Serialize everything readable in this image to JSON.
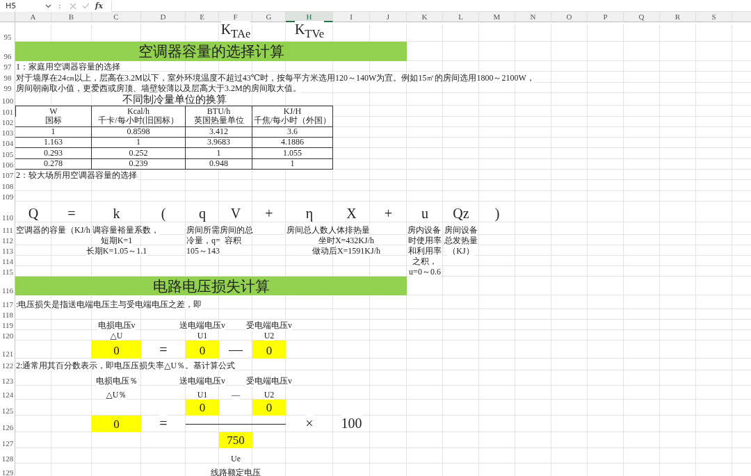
{
  "formula_bar": {
    "name_box": "H5",
    "separator": ":",
    "fx": "fx"
  },
  "columns": [
    {
      "letter": "A",
      "selected": false
    },
    {
      "letter": "B",
      "selected": false
    },
    {
      "letter": "C",
      "selected": false
    },
    {
      "letter": "D",
      "selected": false
    },
    {
      "letter": "E",
      "selected": false
    },
    {
      "letter": "F",
      "selected": false
    },
    {
      "letter": "G",
      "selected": false
    },
    {
      "letter": "H",
      "selected": true
    },
    {
      "letter": "I",
      "selected": false
    },
    {
      "letter": "J",
      "selected": false
    },
    {
      "letter": "K",
      "selected": false
    },
    {
      "letter": "L",
      "selected": false
    },
    {
      "letter": "M",
      "selected": false
    },
    {
      "letter": "N",
      "selected": false
    },
    {
      "letter": "O",
      "selected": false
    },
    {
      "letter": "P",
      "selected": false
    },
    {
      "letter": "Q",
      "selected": false
    },
    {
      "letter": "R",
      "selected": false
    },
    {
      "letter": "S",
      "selected": false
    }
  ],
  "rows": [
    {
      "number": "95",
      "cells": {
        "F": {
          "kind": "symbol",
          "text": "K$_{TAe}$"
        },
        "H": {
          "kind": "symbol",
          "text": "K$_{TVe}$"
        }
      }
    },
    {
      "number": "96",
      "cells": {
        "A-J": {
          "kind": "title",
          "text": "空调器容量的选择计算"
        }
      }
    },
    {
      "number": "97",
      "cells": {
        "A": {
          "kind": "text",
          "text": "1：家庭用空调器容量的选择"
        }
      }
    },
    {
      "number": "98",
      "cells": {
        "A": {
          "kind": "text",
          "text": "对于墙厚在24㎝以上，层高在3.2M以下，室外环境温度不超过43℃时，按每平方米选用120～140W为宜。例如15㎡的房间选用1800～2100W，"
        }
      }
    },
    {
      "number": "99",
      "cells": {
        "A": {
          "kind": "text",
          "text": "房间朝南取小值，更爱西或房顶、墙壁较薄以及层高大于3.2M的房间取大值。"
        }
      }
    },
    {
      "number": "100",
      "cells": {
        "A-H": {
          "kind": "heading",
          "text": "不同制冷量单位的换算"
        }
      }
    },
    {
      "number": "101",
      "cells": {
        "A-B": {
          "kind": "table-head",
          "text": "W"
        },
        "C-D": {
          "kind": "table-head",
          "text": "Kcal/h"
        },
        "E-F": {
          "kind": "table-head",
          "text": "BTU/h"
        },
        "G-H": {
          "kind": "table-head",
          "text": "KJ/H"
        }
      }
    },
    {
      "number": "102",
      "cells": {
        "A-B": {
          "kind": "table-sub",
          "text": "国标"
        },
        "C-D": {
          "kind": "table-sub",
          "text": "千卡/每小时(旧国标）"
        },
        "E-F": {
          "kind": "table-sub",
          "text": "英国热量单位"
        },
        "G-H": {
          "kind": "table-sub",
          "text": "千焦/每小时（外国）"
        }
      }
    },
    {
      "number": "103",
      "cells": {
        "A-B": {
          "kind": "table",
          "text": "1"
        },
        "C-D": {
          "kind": "table",
          "text": "0.8598"
        },
        "E-F": {
          "kind": "table",
          "text": "3.412"
        },
        "G-H": {
          "kind": "table",
          "text": "3.6"
        }
      }
    },
    {
      "number": "104",
      "cells": {
        "A-B": {
          "kind": "table",
          "text": "1.163"
        },
        "C-D": {
          "kind": "table",
          "text": "1"
        },
        "E-F": {
          "kind": "table",
          "text": "3.9683"
        },
        "G-H": {
          "kind": "table",
          "text": "4.1886"
        }
      }
    },
    {
      "number": "105",
      "cells": {
        "A-B": {
          "kind": "table",
          "text": "0.293"
        },
        "C-D": {
          "kind": "table",
          "text": "0.252"
        },
        "E-F": {
          "kind": "table",
          "text": "1"
        },
        "G-H": {
          "kind": "table",
          "text": "1.055"
        }
      }
    },
    {
      "number": "106",
      "cells": {
        "A-B": {
          "kind": "table",
          "text": "0.278"
        },
        "C-D": {
          "kind": "table",
          "text": "0.239"
        },
        "E-F": {
          "kind": "table",
          "text": "0.948"
        },
        "G-H": {
          "kind": "table",
          "text": "1"
        }
      }
    },
    {
      "number": "107",
      "cells": {
        "A": {
          "kind": "text",
          "text": "2：较大场所用空调器容量的选择"
        }
      }
    },
    {
      "number": "108"
    },
    {
      "number": "109"
    },
    {
      "number": "110",
      "cells": {
        "A": {
          "kind": "symbol",
          "text": "Q"
        },
        "B": {
          "kind": "symbol",
          "text": "="
        },
        "C": {
          "kind": "symbol",
          "text": "k"
        },
        "D": {
          "kind": "symbol",
          "text": "("
        },
        "E": {
          "kind": "symbol",
          "text": "q"
        },
        "F": {
          "kind": "symbol",
          "text": "V"
        },
        "G": {
          "kind": "symbol",
          "text": "+"
        },
        "H": {
          "kind": "symbol",
          "text": "η"
        },
        "I": {
          "kind": "symbol",
          "text": "X"
        },
        "J": {
          "kind": "symbol",
          "text": "+"
        },
        "K": {
          "kind": "symbol",
          "text": "u"
        },
        "L": {
          "kind": "symbol",
          "text": "Qz"
        },
        "M": {
          "kind": "symbol",
          "text": ")"
        }
      }
    },
    {
      "number": "111",
      "cells": {
        "A": {
          "kind": "text",
          "text": "空调器的容量（KJ/h"
        },
        "C": {
          "kind": "text",
          "text": "调容量裕量系数，"
        },
        "E": {
          "kind": "text",
          "text": "房间所需房间的总"
        },
        "H": {
          "kind": "text",
          "text": "房间总人数人体排热量"
        },
        "K": {
          "kind": "text",
          "text": "房内设备"
        },
        "L": {
          "kind": "center",
          "text": "房间设备"
        }
      }
    },
    {
      "number": "112",
      "cells": {
        "C": {
          "kind": "center",
          "text": "短期K=1"
        },
        "E": {
          "kind": "text",
          "text": "冷量，q=  容积"
        },
        "H-J": {
          "kind": "center",
          "text": "坐时X=432KJ/h"
        },
        "K": {
          "kind": "center",
          "text": "时使用率"
        },
        "L": {
          "kind": "center",
          "text": "总发热量"
        }
      }
    },
    {
      "number": "113",
      "cells": {
        "C": {
          "kind": "center",
          "text": "长期K=1.05～1.1"
        },
        "E": {
          "kind": "text",
          "text": "105～143"
        },
        "H-J": {
          "kind": "center",
          "text": "做动后X=1591KJ/h"
        },
        "K": {
          "kind": "center",
          "text": "和利用率"
        },
        "L": {
          "kind": "center",
          "text": "（KJ）"
        }
      }
    },
    {
      "number": "114",
      "cells": {
        "K": {
          "kind": "center",
          "text": "之积，"
        }
      }
    },
    {
      "number": "115",
      "cells": {
        "K": {
          "kind": "center",
          "text": "u=0～0.6"
        }
      }
    },
    {
      "number": "116",
      "cells": {
        "A-J": {
          "kind": "title",
          "text": "电路电压损失计算"
        }
      }
    },
    {
      "number": "117",
      "cells": {
        "A": {
          "kind": "text",
          "text": ":电压损失是指送电端电压主与受电端电压之差，即"
        }
      }
    },
    {
      "number": "118"
    },
    {
      "number": "119",
      "cells": {
        "C": {
          "kind": "center",
          "text": "电损电压v"
        },
        "E": {
          "kind": "center",
          "text": "送电端电压v"
        },
        "G": {
          "kind": "center",
          "text": "受电端电压v"
        }
      }
    },
    {
      "number": "120",
      "cells": {
        "C": {
          "kind": "center",
          "text": "△U"
        },
        "E": {
          "kind": "center",
          "text": "U1"
        },
        "G": {
          "kind": "center",
          "text": "U2"
        }
      }
    },
    {
      "number": "121",
      "cells": {
        "C": {
          "kind": "input",
          "text": "0"
        },
        "D": {
          "kind": "symbol",
          "text": "="
        },
        "E": {
          "kind": "input",
          "text": "0"
        },
        "F": {
          "kind": "symbol",
          "text": "—"
        },
        "G": {
          "kind": "input",
          "text": "0"
        }
      }
    },
    {
      "number": "122",
      "cells": {
        "A": {
          "kind": "text",
          "text": "2:通常用其百分数表示，即电压压损失率△U％。基计算公式"
        }
      }
    },
    {
      "number": "123",
      "cells": {
        "C": {
          "kind": "center",
          "text": "电损电压％"
        },
        "E": {
          "kind": "center",
          "text": "送电端电压v"
        },
        "G": {
          "kind": "center",
          "text": "受电端电压v"
        }
      }
    },
    {
      "number": "124",
      "cells": {
        "C": {
          "kind": "center",
          "text": "△U％"
        },
        "E": {
          "kind": "center",
          "text": "U1"
        },
        "F": {
          "kind": "center",
          "text": "—"
        },
        "G": {
          "kind": "center",
          "text": "U2"
        }
      }
    },
    {
      "number": "125",
      "cells": {
        "E": {
          "kind": "input",
          "text": "0"
        },
        "G": {
          "kind": "input",
          "text": "0"
        }
      }
    },
    {
      "number": "126",
      "cells": {
        "C": {
          "kind": "input",
          "text": "0"
        },
        "D": {
          "kind": "symbol",
          "text": "="
        },
        "E-G": {
          "kind": "fraction_bar"
        },
        "H": {
          "kind": "symbol",
          "text": "×"
        },
        "I": {
          "kind": "symbol",
          "text": "100"
        }
      }
    },
    {
      "number": "127",
      "cells": {
        "F": {
          "kind": "input",
          "text": "750"
        }
      }
    },
    {
      "number": "128",
      "cells": {
        "F": {
          "kind": "center",
          "text": "Ue"
        }
      }
    },
    {
      "number": "129",
      "cells": {
        "E-G": {
          "kind": "center",
          "text": "线路额定电压"
        }
      }
    }
  ]
}
